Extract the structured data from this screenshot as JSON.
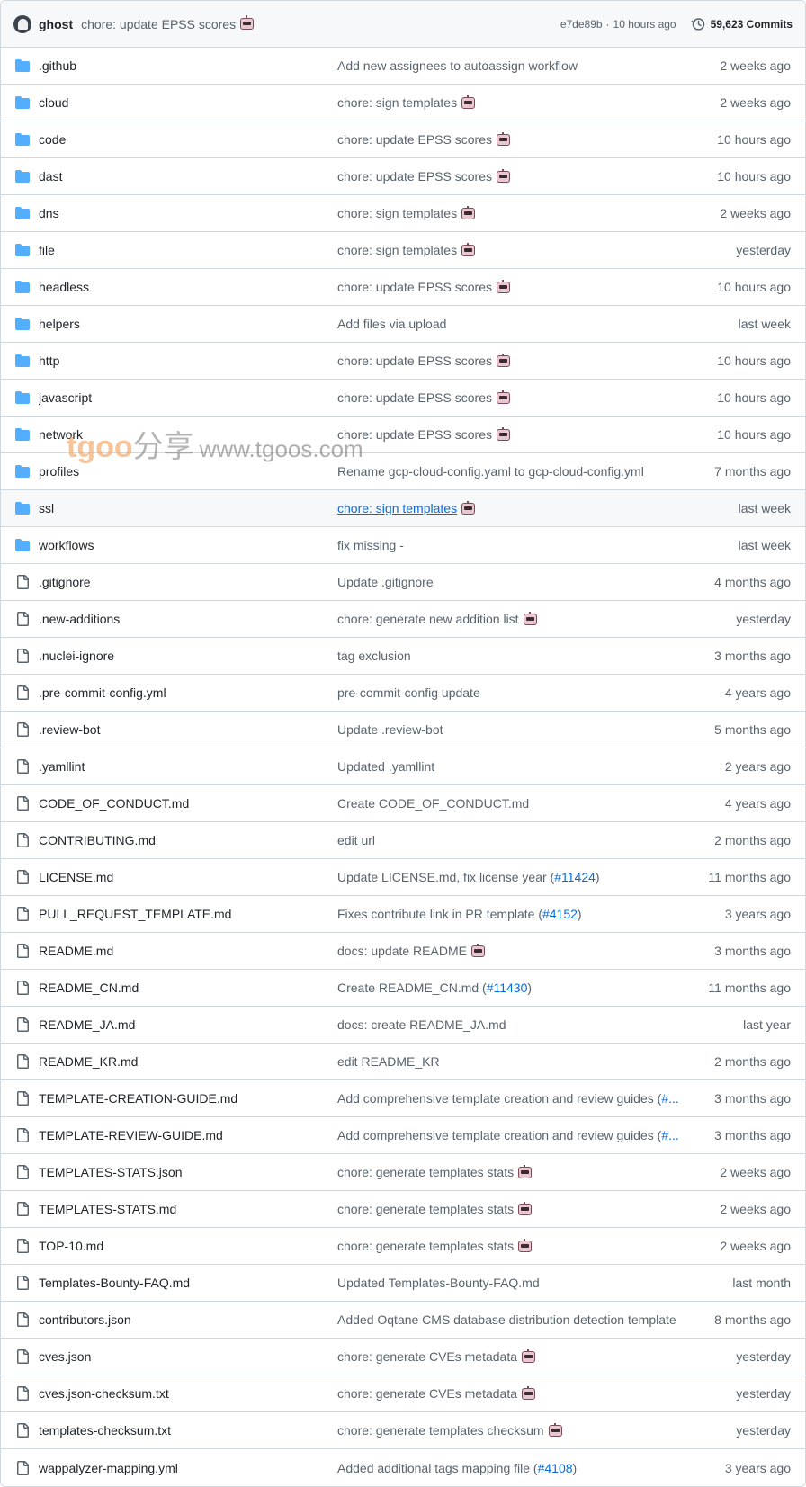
{
  "header": {
    "author": "ghost",
    "message": "chore: update EPSS scores",
    "sha": "e7de89b",
    "separator": "·",
    "time": "10 hours ago",
    "commits": "59,623 Commits"
  },
  "rows": [
    {
      "type": "folder",
      "name": ".github",
      "message": "Add new assignees to autoassign workflow",
      "date": "2 weeks ago"
    },
    {
      "type": "folder",
      "name": "cloud",
      "message": "chore: sign templates",
      "bot": true,
      "date": "2 weeks ago"
    },
    {
      "type": "folder",
      "name": "code",
      "message": "chore: update EPSS scores",
      "bot": true,
      "date": "10 hours ago"
    },
    {
      "type": "folder",
      "name": "dast",
      "message": "chore: update EPSS scores",
      "bot": true,
      "date": "10 hours ago"
    },
    {
      "type": "folder",
      "name": "dns",
      "message": "chore: sign templates",
      "bot": true,
      "date": "2 weeks ago"
    },
    {
      "type": "folder",
      "name": "file",
      "message": "chore: sign templates",
      "bot": true,
      "date": "yesterday"
    },
    {
      "type": "folder",
      "name": "headless",
      "message": "chore: update EPSS scores",
      "bot": true,
      "date": "10 hours ago"
    },
    {
      "type": "folder",
      "name": "helpers",
      "message": "Add files via upload",
      "date": "last week"
    },
    {
      "type": "folder",
      "name": "http",
      "message": "chore: update EPSS scores",
      "bot": true,
      "date": "10 hours ago"
    },
    {
      "type": "folder",
      "name": "javascript",
      "message": "chore: update EPSS scores",
      "bot": true,
      "date": "10 hours ago"
    },
    {
      "type": "folder",
      "name": "network",
      "message": "chore: update EPSS scores",
      "bot": true,
      "date": "10 hours ago"
    },
    {
      "type": "folder",
      "name": "profiles",
      "message": "Rename gcp-cloud-config.yaml to gcp-cloud-config.yml",
      "date": "7 months ago"
    },
    {
      "type": "folder",
      "name": "ssl",
      "message": "chore: sign templates",
      "bot": true,
      "date": "last week",
      "hovered": true
    },
    {
      "type": "folder",
      "name": "workflows",
      "message": "fix missing -",
      "date": "last week"
    },
    {
      "type": "file",
      "name": ".gitignore",
      "message": "Update .gitignore",
      "date": "4 months ago"
    },
    {
      "type": "file",
      "name": ".new-additions",
      "message": "chore: generate new addition list",
      "bot": true,
      "date": "yesterday"
    },
    {
      "type": "file",
      "name": ".nuclei-ignore",
      "message": "tag exclusion",
      "date": "3 months ago"
    },
    {
      "type": "file",
      "name": ".pre-commit-config.yml",
      "message": "pre-commit-config update",
      "date": "4 years ago"
    },
    {
      "type": "file",
      "name": ".review-bot",
      "message": "Update .review-bot",
      "date": "5 months ago"
    },
    {
      "type": "file",
      "name": ".yamllint",
      "message": "Updated .yamllint",
      "date": "2 years ago"
    },
    {
      "type": "file",
      "name": "CODE_OF_CONDUCT.md",
      "message": "Create CODE_OF_CONDUCT.md",
      "date": "4 years ago"
    },
    {
      "type": "file",
      "name": "CONTRIBUTING.md",
      "message": "edit url",
      "date": "2 months ago"
    },
    {
      "type": "file",
      "name": "LICENSE.md",
      "message": "Update LICENSE.md, fix license year (",
      "link": "#11424",
      "message_after": ")",
      "date": "11 months ago"
    },
    {
      "type": "file",
      "name": "PULL_REQUEST_TEMPLATE.md",
      "message": "Fixes contribute link in PR template (",
      "link": "#4152",
      "message_after": ")",
      "date": "3 years ago"
    },
    {
      "type": "file",
      "name": "README.md",
      "message": "docs: update README",
      "bot": true,
      "date": "3 months ago"
    },
    {
      "type": "file",
      "name": "README_CN.md",
      "message": "Create README_CN.md (",
      "link": "#11430",
      "message_after": ")",
      "date": "11 months ago"
    },
    {
      "type": "file",
      "name": "README_JA.md",
      "message": "docs: create README_JA.md",
      "date": "last year"
    },
    {
      "type": "file",
      "name": "README_KR.md",
      "message": "edit README_KR",
      "date": "2 months ago"
    },
    {
      "type": "file",
      "name": "TEMPLATE-CREATION-GUIDE.md",
      "message": "Add comprehensive template creation and review guides (",
      "link": "#...",
      "date": "3 months ago"
    },
    {
      "type": "file",
      "name": "TEMPLATE-REVIEW-GUIDE.md",
      "message": "Add comprehensive template creation and review guides (",
      "link": "#...",
      "date": "3 months ago"
    },
    {
      "type": "file",
      "name": "TEMPLATES-STATS.json",
      "message": "chore: generate templates stats",
      "bot": true,
      "date": "2 weeks ago"
    },
    {
      "type": "file",
      "name": "TEMPLATES-STATS.md",
      "message": "chore: generate templates stats",
      "bot": true,
      "date": "2 weeks ago"
    },
    {
      "type": "file",
      "name": "TOP-10.md",
      "message": "chore: generate templates stats",
      "bot": true,
      "date": "2 weeks ago"
    },
    {
      "type": "file",
      "name": "Templates-Bounty-FAQ.md",
      "message": "Updated Templates-Bounty-FAQ.md",
      "date": "last month"
    },
    {
      "type": "file",
      "name": "contributors.json",
      "message": "Added Oqtane CMS database distribution detection template",
      "date": "8 months ago"
    },
    {
      "type": "file",
      "name": "cves.json",
      "message": "chore: generate CVEs metadata",
      "bot": true,
      "date": "yesterday"
    },
    {
      "type": "file",
      "name": "cves.json-checksum.txt",
      "message": "chore: generate CVEs metadata",
      "bot": true,
      "date": "yesterday"
    },
    {
      "type": "file",
      "name": "templates-checksum.txt",
      "message": "chore: generate templates checksum",
      "bot": true,
      "date": "yesterday"
    },
    {
      "type": "file",
      "name": "wappalyzer-mapping.yml",
      "message": "Added additional tags mapping file (",
      "link": "#4108",
      "message_after": ")",
      "date": "3 years ago"
    }
  ],
  "watermark": {
    "brand": "tgoo",
    "cn": "分享",
    "url": "www.tgoos.com"
  },
  "colors": {
    "folder": "#54aeff",
    "link": "#0969da",
    "muted": "#59636e",
    "border": "#d1d9e0"
  }
}
